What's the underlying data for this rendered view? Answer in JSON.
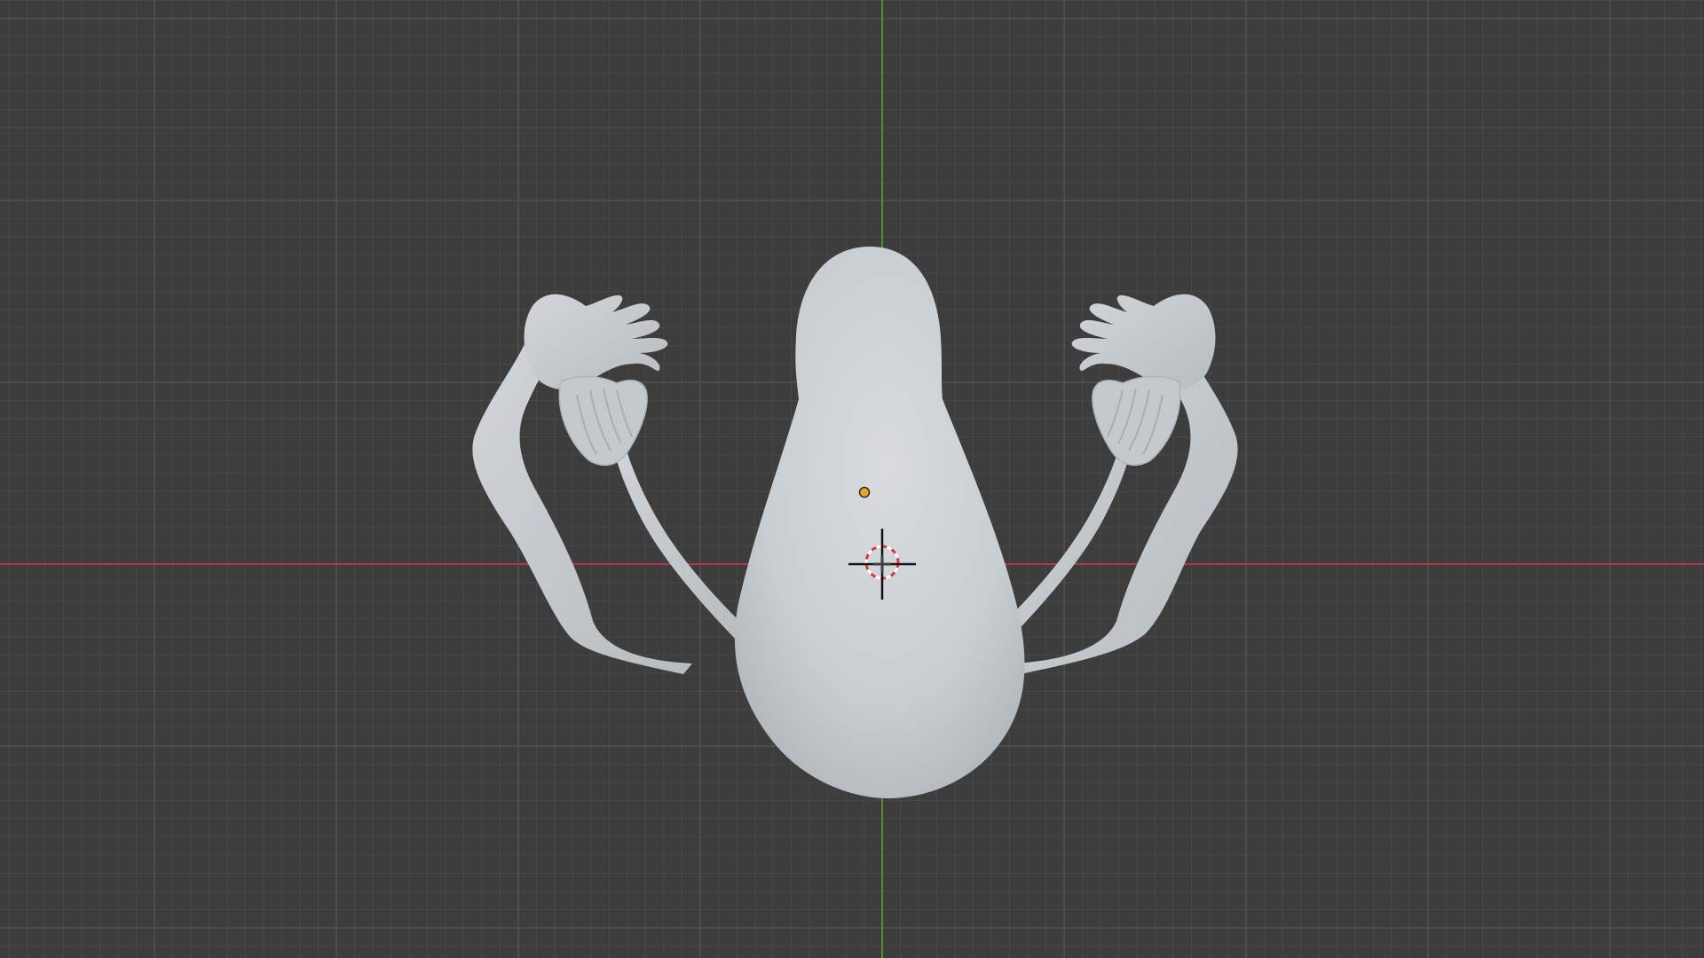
{
  "viewport": {
    "editor": "3D Viewport",
    "background_color": "#3d3d3d",
    "grid_minor_color": "#474747",
    "grid_major_color": "#525252",
    "x_axis_color": "#b23a48",
    "y_axis_color": "#5b8a2d",
    "model_color": "#c9ced3",
    "origin_color": "#e8a435",
    "cursor_ring_color": "#d83a3a"
  },
  "scene": {
    "selected_object": "sculpted-figure",
    "object_origin_icon": "origin-dot-icon",
    "cursor_icon": "3d-cursor-icon"
  }
}
